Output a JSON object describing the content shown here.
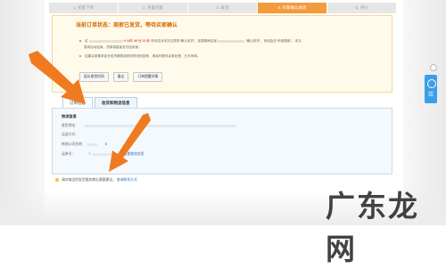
{
  "steps": [
    "1. 买家下单",
    "2. 买家付款",
    "3. 发货",
    "4. 买家确认收货",
    "5. 评价"
  ],
  "active_step": 3,
  "notice": {
    "title": "当前订单状态：商家已发货，等待买家确认",
    "line1_prefix": "买",
    "line1_timer": "9 小时 46 分 23 秒",
    "line1_mid": "未完成对本次交易的“确认收货”，如果期间买家",
    "line1_suffix": "“确认收货”，系统会在“申请退款”，本交",
    "line2": "易将自动结束，货款将直接支付给卖家。",
    "line3": "如果买家要求延长收货期限或修改物流信息等，请及时联系买家处理，方可申请。",
    "buttons": [
      "延长收货时间",
      "备忘",
      "订单提醒详情"
    ]
  },
  "tabs": [
    "订单信息",
    "收货和物流信息"
  ],
  "panel": {
    "title": "物流信息",
    "rows": [
      {
        "label": "收货地址：",
        "value": ""
      },
      {
        "label": "运送方式：",
        "value": ""
      },
      {
        "label": "物流公司名称：",
        "value": "$"
      },
      {
        "label": "运单号：",
        "value": "?"
      }
    ],
    "view_link": "? 查看物流信息"
  },
  "footer": {
    "text": "请对商品的发货服务做出满意建议，",
    "link": "查询联系方式"
  },
  "watermark": "广东龙网",
  "colors": {
    "active_step": "#f39a3c",
    "arrow": "#f07a1f",
    "link": "#2f6fb5",
    "notice_bg": "#fffbea",
    "float_tool": "#3b9ee8"
  },
  "icons": [
    "arrow-icon",
    "scroll-top-icon",
    "float-tool-icon"
  ]
}
